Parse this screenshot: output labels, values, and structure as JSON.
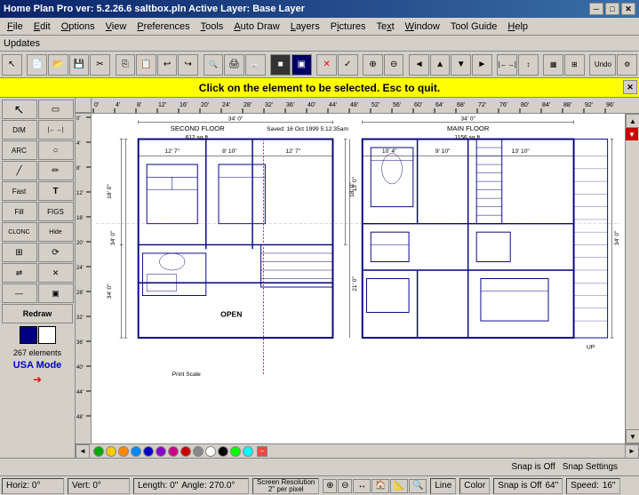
{
  "titlebar": {
    "title": "Home Plan Pro ver: 5.2.26.6    saltbox.pln    Active Layer: Base Layer",
    "min_label": "─",
    "max_label": "□",
    "close_label": "✕"
  },
  "menubar": {
    "items": [
      {
        "label": "File",
        "id": "file"
      },
      {
        "label": "Edit",
        "id": "edit"
      },
      {
        "label": "Options",
        "id": "options"
      },
      {
        "label": "View",
        "id": "view"
      },
      {
        "label": "Preferences",
        "id": "preferences"
      },
      {
        "label": "Tools",
        "id": "tools"
      },
      {
        "label": "Auto Draw",
        "id": "autodraw"
      },
      {
        "label": "Layers",
        "id": "layers"
      },
      {
        "label": "Pictures",
        "id": "pictures"
      },
      {
        "label": "Text",
        "id": "text"
      },
      {
        "label": "Window",
        "id": "window"
      },
      {
        "label": "Tool Guide",
        "id": "toolguide"
      },
      {
        "label": "Help",
        "id": "help"
      }
    ]
  },
  "updates_bar": {
    "label": "Updates"
  },
  "notification": {
    "text": "Click on the element to be selected.  Esc to quit.",
    "close_label": "✕"
  },
  "left_toolbar": {
    "redraw_label": "Redraw",
    "element_count": "267 elements",
    "usa_mode": "USA Mode",
    "dim_label": "DIM",
    "arc_label": "ARC",
    "fast_label": "Fast",
    "fill_label": "Fill",
    "figs_label": "FIGS",
    "clonc_label": "CLONC",
    "hide_label": "Hide"
  },
  "status_bar_1": {
    "snap_label": "Snap Settings",
    "colors": [
      "#00aa00",
      "#ffff00",
      "#ff8800",
      "#00aaff",
      "#0000ff",
      "#8800ff",
      "#ff00ff",
      "#ff0000",
      "#888888",
      "#ffffff",
      "#000000",
      "#00ff00",
      "#00ffff"
    ]
  },
  "status_bar_2": {
    "horiz_label": "Horiz: 0°",
    "vert_label": "Vert: 0°",
    "length_label": "Length: 0\"",
    "angle_label": "Angle: 270.0°",
    "resolution_label": "Screen Resolution",
    "resolution_value": "2\" per pixel",
    "line_label": "Line",
    "color_label": "Color",
    "snap_off_label": "Snap is Off",
    "snap_value": "64\"",
    "speed_label": "Speed:",
    "speed_value": "16\""
  },
  "ruler": {
    "marks": [
      "0'",
      "4'",
      "8'",
      "12'",
      "16'",
      "20'",
      "24'",
      "28'",
      "32'",
      "36'",
      "40'",
      "44'",
      "48'",
      "52'",
      "56'",
      "60'",
      "64'",
      "68'",
      "72'",
      "76'",
      "80'",
      "84'",
      "88'",
      "92'",
      "96'"
    ]
  },
  "floor_plan": {
    "second_floor_label": "SECOND FLOOR",
    "second_floor_sqft": "612 sq ft.",
    "main_floor_label": "MAIN FLOOR",
    "main_floor_sqft": "1156 sq ft.",
    "saved_label": "Saved: 16 Oct 1999  5:12:35am",
    "open_label": "OPEN",
    "print_scale_label": "Print Scale",
    "dim_34_left": "34' 0\"",
    "dim_34_right": "34' 0\"",
    "dim_12_7": "12' 7\"",
    "dim_8_10": "8' 10\"",
    "dim_12_7b": "12' 7\"",
    "dim_10_4": "10' 4\"",
    "dim_9_10": "9' 10\"",
    "dim_13_10": "13' 10\"",
    "dim_18_0": "18' 0\"",
    "dim_34_0v": "34' 0\"",
    "dim_34_0v2": "34' 0\"",
    "dim_16_0": "16' 0\"",
    "dim_13_0": "13' 0\"",
    "dim_21_0": "21' 0\""
  }
}
